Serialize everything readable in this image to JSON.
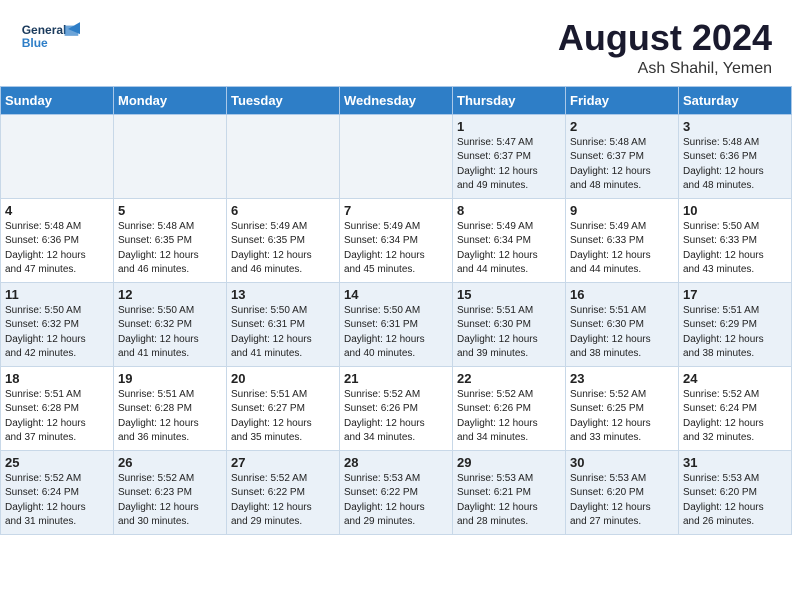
{
  "header": {
    "logo_line1": "General",
    "logo_line2": "Blue",
    "month": "August 2024",
    "location": "Ash Shahil, Yemen"
  },
  "weekdays": [
    "Sunday",
    "Monday",
    "Tuesday",
    "Wednesday",
    "Thursday",
    "Friday",
    "Saturday"
  ],
  "weeks": [
    [
      {
        "day": "",
        "detail": ""
      },
      {
        "day": "",
        "detail": ""
      },
      {
        "day": "",
        "detail": ""
      },
      {
        "day": "",
        "detail": ""
      },
      {
        "day": "1",
        "detail": "Sunrise: 5:47 AM\nSunset: 6:37 PM\nDaylight: 12 hours\nand 49 minutes."
      },
      {
        "day": "2",
        "detail": "Sunrise: 5:48 AM\nSunset: 6:37 PM\nDaylight: 12 hours\nand 48 minutes."
      },
      {
        "day": "3",
        "detail": "Sunrise: 5:48 AM\nSunset: 6:36 PM\nDaylight: 12 hours\nand 48 minutes."
      }
    ],
    [
      {
        "day": "4",
        "detail": "Sunrise: 5:48 AM\nSunset: 6:36 PM\nDaylight: 12 hours\nand 47 minutes."
      },
      {
        "day": "5",
        "detail": "Sunrise: 5:48 AM\nSunset: 6:35 PM\nDaylight: 12 hours\nand 46 minutes."
      },
      {
        "day": "6",
        "detail": "Sunrise: 5:49 AM\nSunset: 6:35 PM\nDaylight: 12 hours\nand 46 minutes."
      },
      {
        "day": "7",
        "detail": "Sunrise: 5:49 AM\nSunset: 6:34 PM\nDaylight: 12 hours\nand 45 minutes."
      },
      {
        "day": "8",
        "detail": "Sunrise: 5:49 AM\nSunset: 6:34 PM\nDaylight: 12 hours\nand 44 minutes."
      },
      {
        "day": "9",
        "detail": "Sunrise: 5:49 AM\nSunset: 6:33 PM\nDaylight: 12 hours\nand 44 minutes."
      },
      {
        "day": "10",
        "detail": "Sunrise: 5:50 AM\nSunset: 6:33 PM\nDaylight: 12 hours\nand 43 minutes."
      }
    ],
    [
      {
        "day": "11",
        "detail": "Sunrise: 5:50 AM\nSunset: 6:32 PM\nDaylight: 12 hours\nand 42 minutes."
      },
      {
        "day": "12",
        "detail": "Sunrise: 5:50 AM\nSunset: 6:32 PM\nDaylight: 12 hours\nand 41 minutes."
      },
      {
        "day": "13",
        "detail": "Sunrise: 5:50 AM\nSunset: 6:31 PM\nDaylight: 12 hours\nand 41 minutes."
      },
      {
        "day": "14",
        "detail": "Sunrise: 5:50 AM\nSunset: 6:31 PM\nDaylight: 12 hours\nand 40 minutes."
      },
      {
        "day": "15",
        "detail": "Sunrise: 5:51 AM\nSunset: 6:30 PM\nDaylight: 12 hours\nand 39 minutes."
      },
      {
        "day": "16",
        "detail": "Sunrise: 5:51 AM\nSunset: 6:30 PM\nDaylight: 12 hours\nand 38 minutes."
      },
      {
        "day": "17",
        "detail": "Sunrise: 5:51 AM\nSunset: 6:29 PM\nDaylight: 12 hours\nand 38 minutes."
      }
    ],
    [
      {
        "day": "18",
        "detail": "Sunrise: 5:51 AM\nSunset: 6:28 PM\nDaylight: 12 hours\nand 37 minutes."
      },
      {
        "day": "19",
        "detail": "Sunrise: 5:51 AM\nSunset: 6:28 PM\nDaylight: 12 hours\nand 36 minutes."
      },
      {
        "day": "20",
        "detail": "Sunrise: 5:51 AM\nSunset: 6:27 PM\nDaylight: 12 hours\nand 35 minutes."
      },
      {
        "day": "21",
        "detail": "Sunrise: 5:52 AM\nSunset: 6:26 PM\nDaylight: 12 hours\nand 34 minutes."
      },
      {
        "day": "22",
        "detail": "Sunrise: 5:52 AM\nSunset: 6:26 PM\nDaylight: 12 hours\nand 34 minutes."
      },
      {
        "day": "23",
        "detail": "Sunrise: 5:52 AM\nSunset: 6:25 PM\nDaylight: 12 hours\nand 33 minutes."
      },
      {
        "day": "24",
        "detail": "Sunrise: 5:52 AM\nSunset: 6:24 PM\nDaylight: 12 hours\nand 32 minutes."
      }
    ],
    [
      {
        "day": "25",
        "detail": "Sunrise: 5:52 AM\nSunset: 6:24 PM\nDaylight: 12 hours\nand 31 minutes."
      },
      {
        "day": "26",
        "detail": "Sunrise: 5:52 AM\nSunset: 6:23 PM\nDaylight: 12 hours\nand 30 minutes."
      },
      {
        "day": "27",
        "detail": "Sunrise: 5:52 AM\nSunset: 6:22 PM\nDaylight: 12 hours\nand 29 minutes."
      },
      {
        "day": "28",
        "detail": "Sunrise: 5:53 AM\nSunset: 6:22 PM\nDaylight: 12 hours\nand 29 minutes."
      },
      {
        "day": "29",
        "detail": "Sunrise: 5:53 AM\nSunset: 6:21 PM\nDaylight: 12 hours\nand 28 minutes."
      },
      {
        "day": "30",
        "detail": "Sunrise: 5:53 AM\nSunset: 6:20 PM\nDaylight: 12 hours\nand 27 minutes."
      },
      {
        "day": "31",
        "detail": "Sunrise: 5:53 AM\nSunset: 6:20 PM\nDaylight: 12 hours\nand 26 minutes."
      }
    ]
  ]
}
